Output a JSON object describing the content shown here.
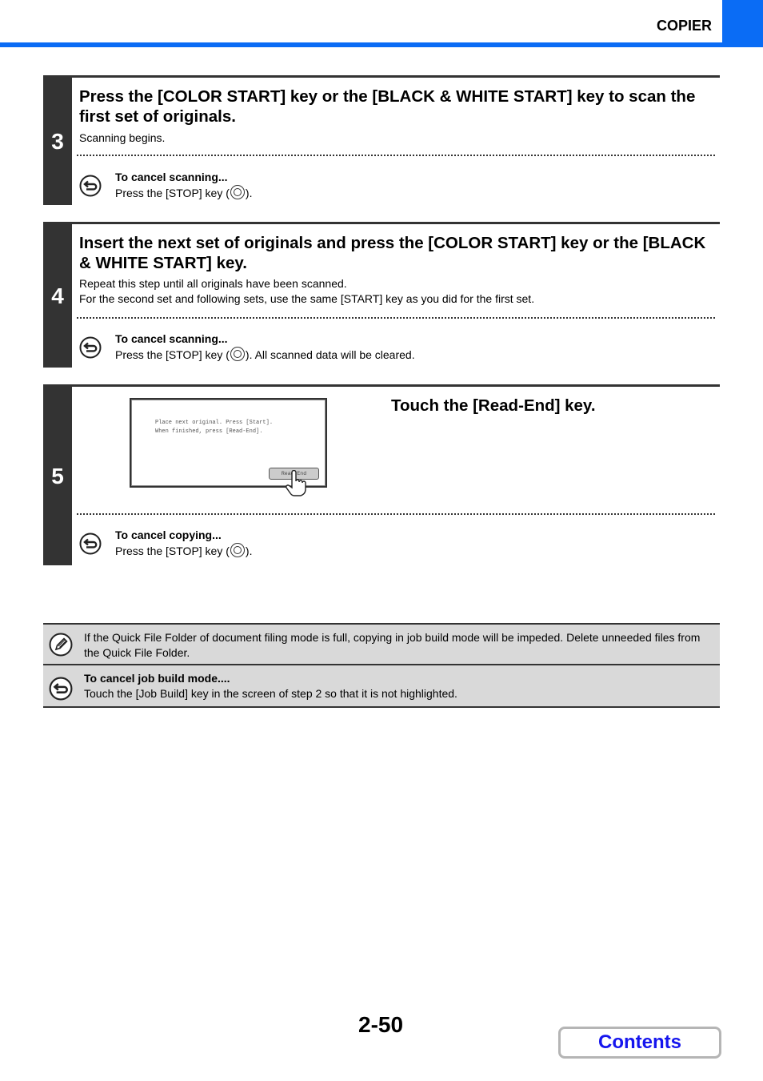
{
  "header": {
    "title": "COPIER",
    "accent_color": "#0a6cf5"
  },
  "steps": [
    {
      "number": "3",
      "title": "Press the [COLOR START] key or the [BLACK & WHITE START] key to scan the first set of originals.",
      "description": [
        "Scanning begins."
      ],
      "cancel": {
        "heading": "To cancel scanning...",
        "text_before": "Press the [STOP] key (",
        "text_after": ")."
      }
    },
    {
      "number": "4",
      "title": "Insert the next set of originals and press the [COLOR START] key or the [BLACK & WHITE START] key.",
      "description": [
        "Repeat this step until all originals have been scanned.",
        "For the second set and following sets, use the same [START] key as you did for the first set."
      ],
      "cancel": {
        "heading": "To cancel scanning...",
        "text_before": "Press the [STOP] key (",
        "text_after": "). All scanned data will be cleared."
      }
    },
    {
      "number": "5",
      "title": "Touch the [Read-End] key.",
      "screen": {
        "message_line1": "Place next original. Press [Start].",
        "message_line2": "When finished, press [Read-End].",
        "button_label": "Read-End"
      },
      "cancel": {
        "heading": "To cancel copying...",
        "text_before": "Press the [STOP] key (",
        "text_after": ")."
      }
    }
  ],
  "notes": [
    {
      "icon": "pencil-note-icon",
      "text": "If the Quick File Folder of document filing mode is full, copying in job build mode will be impeded. Delete unneeded files from the Quick File Folder."
    },
    {
      "icon": "cancel-return-icon",
      "heading": "To cancel job build mode....",
      "text": "Touch the [Job Build] key in the screen of step 2 so that it is not highlighted."
    }
  ],
  "footer": {
    "page_number": "2-50",
    "contents_label": "Contents"
  }
}
